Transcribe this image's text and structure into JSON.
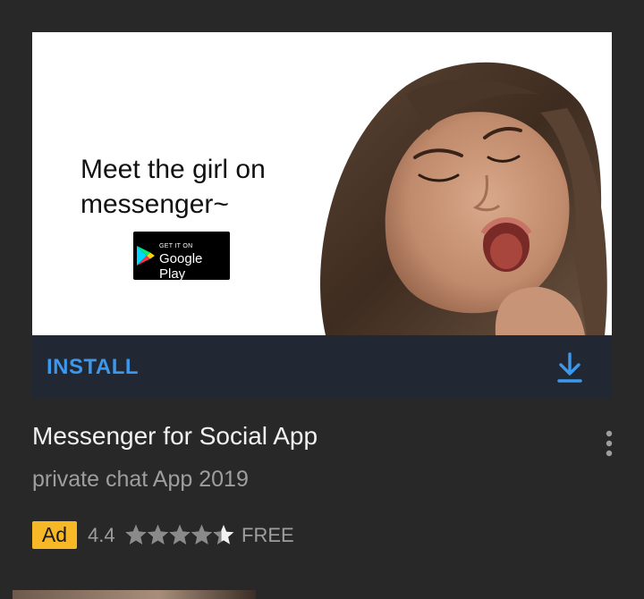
{
  "ad": {
    "headline": "Meet the girl on messenger~",
    "badge_small_text": "GET IT ON",
    "badge_store_name": "Google Play",
    "install_label": "INSTALL",
    "download_icon": "download-arrow-icon"
  },
  "app": {
    "title": "Messenger for Social App",
    "subtitle": "private chat App 2019",
    "ad_label": "Ad",
    "rating": "4.4",
    "rating_value": 4.4,
    "rating_max": 5,
    "price": "FREE",
    "more_icon": "more-vertical-icon"
  },
  "colors": {
    "background": "#282828",
    "install_bar": "#222734",
    "install_text": "#3c98ec",
    "ad_badge": "#f6b827",
    "muted_text": "#9e9e9e"
  }
}
